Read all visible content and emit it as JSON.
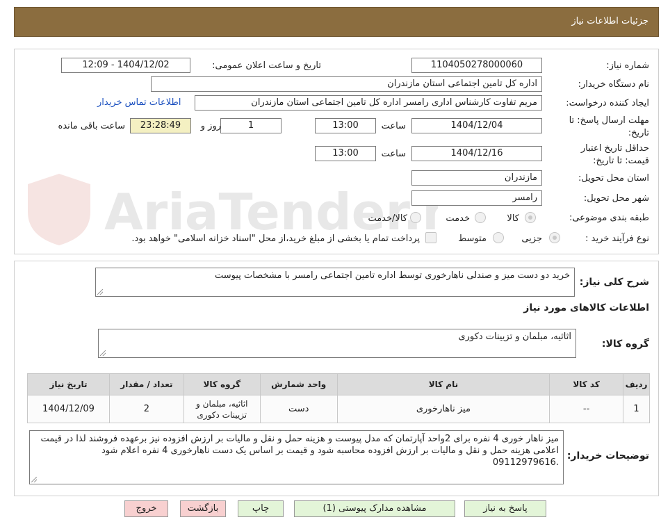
{
  "header": {
    "title": "جزئیات اطلاعات نیاز"
  },
  "watermark": {
    "text": "AriaTender.neT"
  },
  "info": {
    "need_number_label": "شماره نیاز:",
    "need_number": "1104050278000060",
    "announce_label": "تاریخ و ساعت اعلان عمومی:",
    "announce_value": "1404/12/02 - 12:09",
    "buyer_org_label": "نام دستگاه خریدار:",
    "buyer_org": "اداره کل تامین اجتماعی استان مازندران",
    "creator_label": "ایجاد کننده درخواست:",
    "creator": "مریم تفاوت کارشناس اداری رامسر اداره کل تامین اجتماعی استان مازندران",
    "contact_link": "اطلاعات تماس خریدار",
    "deadline_label_1": "مهلت ارسال پاسخ: تا",
    "deadline_label_2": "تاریخ:",
    "deadline_date": "1404/12/04",
    "time_label": "ساعت",
    "deadline_time": "13:00",
    "days_value": "1",
    "days_label": "روز و",
    "remaining_time": "23:28:49",
    "remaining_label": "ساعت باقی مانده",
    "validity_label_1": "حداقل تاریخ اعتبار",
    "validity_label_2": "قیمت: تا تاریخ:",
    "validity_date": "1404/12/16",
    "validity_time": "13:00",
    "province_label": "استان محل تحویل:",
    "province": "مازندران",
    "city_label": "شهر محل تحویل:",
    "city": "رامسر",
    "category_label": "طبقه بندی موضوعی:",
    "category_options": [
      "کالا",
      "خدمت",
      "کالا/خدمت"
    ],
    "process_label": "نوع فرآیند خرید :",
    "process_options": [
      "جزیی",
      "متوسط"
    ],
    "treasury_note": "پرداخت تمام یا بخشی از مبلغ خرید،از محل \"اسناد خزانه اسلامی\" خواهد بود."
  },
  "summary": {
    "label": "شرح کلی نیاز:",
    "text": "خرید دو دست میز و صندلی ناهارخوری توسط اداره تامین اجتماعی رامسر با مشخصات پیوست",
    "goods_title": "اطلاعات کالاهای مورد نیاز",
    "group_label": "گروه کالا:",
    "group_value": "اثاثیه، مبلمان و تزیینات دکوری"
  },
  "table": {
    "headers": [
      "ردیف",
      "کد کالا",
      "نام کالا",
      "واحد شمارش",
      "گروه کالا",
      "تعداد / مقدار",
      "تاریخ نیاز"
    ],
    "rows": [
      {
        "row": "1",
        "code": "--",
        "name": "میز ناهارخوری",
        "unit": "دست",
        "group": "اثاثیه، مبلمان و تزیینات دکوری",
        "qty": "2",
        "date": "1404/12/09"
      }
    ]
  },
  "buyer_notes": {
    "label": "توضیحات خریدار:",
    "text": "میز ناهار خوری 4 نفره برای 2واحد آپارتمان که مدل  پیوست و هزینه حمل و نقل و مالیات بر ارزش افزوده نیز برعهده فروشند لذا در قیمت اعلامی هزینه حمل و نقل و مالیات بر ارزش افزوده محاسبه شود و قیمت بر اساس یک دست ناهارخوری 4 نفره اعلام شود .09112979616"
  },
  "buttons": {
    "reply": "پاسخ به نیاز",
    "attachments": "مشاهده مدارک پیوستی (1)",
    "print": "چاپ",
    "back": "بازگشت",
    "exit": "خروج"
  }
}
